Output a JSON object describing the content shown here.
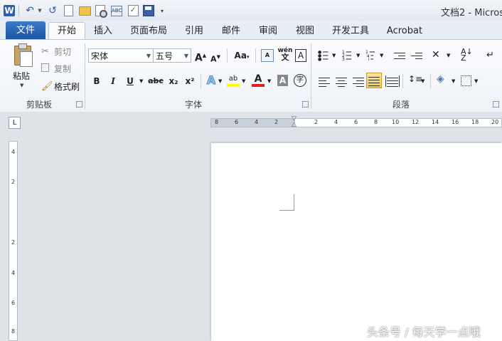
{
  "title_bar": {
    "app_icon": "W",
    "doc_title": "文档2 - Micros",
    "quick_access_icons": [
      "undo-icon",
      "redo-icon",
      "new-doc-icon",
      "open-folder-icon",
      "print-preview-icon",
      "spellcheck-icon",
      "document-check-icon",
      "save-icon",
      "customize-icon"
    ]
  },
  "tabs": [
    {
      "label": "文件"
    },
    {
      "label": "开始"
    },
    {
      "label": "插入"
    },
    {
      "label": "页面布局"
    },
    {
      "label": "引用"
    },
    {
      "label": "邮件"
    },
    {
      "label": "审阅"
    },
    {
      "label": "视图"
    },
    {
      "label": "开发工具"
    },
    {
      "label": "Acrobat"
    }
  ],
  "clipboard": {
    "paste_label": "粘贴",
    "cut_label": "剪切",
    "copy_label": "复制",
    "format_painter_label": "格式刷",
    "group_label": "剪贴板"
  },
  "font": {
    "font_name": "宋体",
    "font_size": "五号",
    "grow_label": "A",
    "shrink_label": "A",
    "case_label": "Aa",
    "pinyin_label": "wén",
    "bold": "B",
    "italic": "I",
    "underline": "U",
    "strike": "abc",
    "subscript": "x₂",
    "superscript": "x²",
    "text_effect": "A",
    "highlight": "ab",
    "font_color": "A",
    "char_shading": "A",
    "enclose": "字",
    "group_label": "字体"
  },
  "paragraph": {
    "group_label": "段落"
  },
  "ruler": {
    "ticks": [
      "8",
      "6",
      "4",
      "2",
      "",
      "2",
      "4",
      "6",
      "8",
      "10",
      "12",
      "14",
      "16",
      "18",
      "20"
    ],
    "vertical_ticks": [
      "4",
      "2",
      "2",
      "4",
      "6",
      "8"
    ],
    "corner": "L"
  },
  "watermark": "头条号 / 每天学一点哦",
  "colors": {
    "file_tab": "#2b65b3",
    "accent_blue": "#1c55a5",
    "highlight_yellow": "#ffff00",
    "font_red": "#e0201c"
  }
}
